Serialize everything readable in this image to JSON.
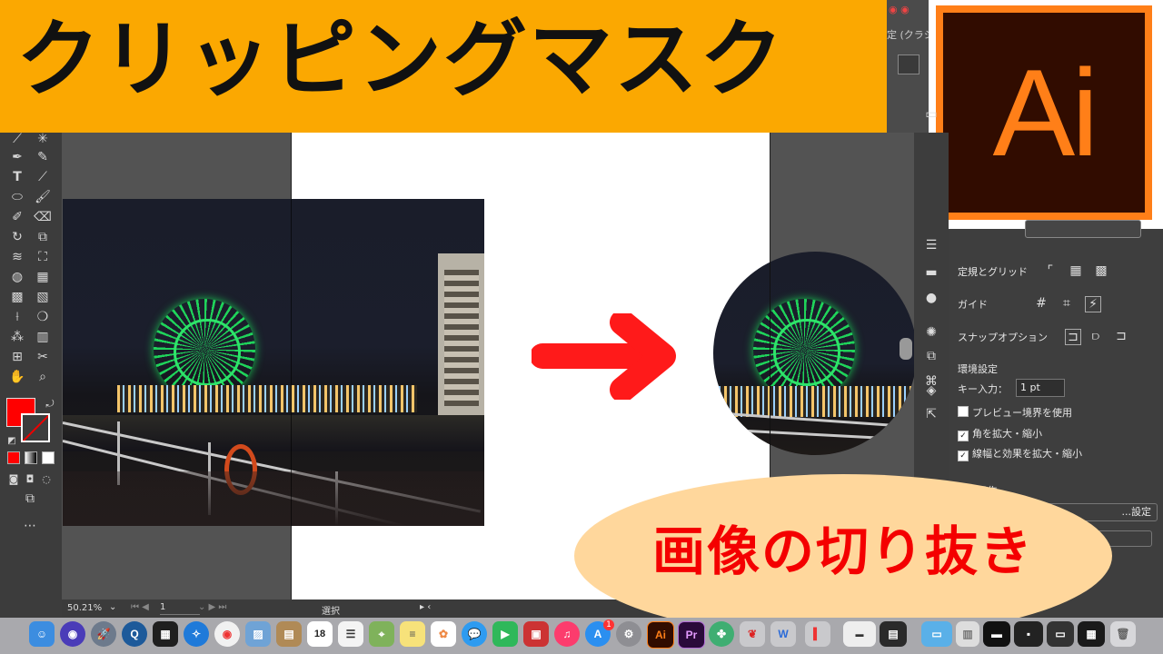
{
  "banner": {
    "title": "クリッピングマスク"
  },
  "overlay": {
    "subtitle": "画像の切り抜き"
  },
  "logo": {
    "text": "Ai"
  },
  "menu": {
    "workspace": "定 (クラシ"
  },
  "panel": {
    "rulers_grid_label": "定規とグリッド",
    "guides_label": "ガイド",
    "snap_label": "スナップオプション",
    "prefs_heading": "環境設定",
    "key_input_label": "キー入力：",
    "key_input_value": "1 pt",
    "preview_bounds_label": "プレビュー境界を使用",
    "scale_corners_label": "角を拡大・縮小",
    "scale_strokes_label": "線幅と効果を拡大・縮小",
    "quick_actions_label": "...ク操作",
    "settings_label": "...設定"
  },
  "status": {
    "zoom": "50.21%",
    "artboard_num": "1",
    "tool_name": "選択"
  },
  "dock": {
    "calendar_day": "18",
    "badge_count": "1",
    "ai_label": "Ai",
    "pr_label": "Pr"
  },
  "colors": {
    "banner": "#fba801",
    "ai_orange": "#ff7f18",
    "ai_dark": "#310c00",
    "arrow": "#ff1a1a",
    "oval": "#ffd79c",
    "oval_text": "#f40000",
    "fill_swatch": "#ff0000"
  }
}
